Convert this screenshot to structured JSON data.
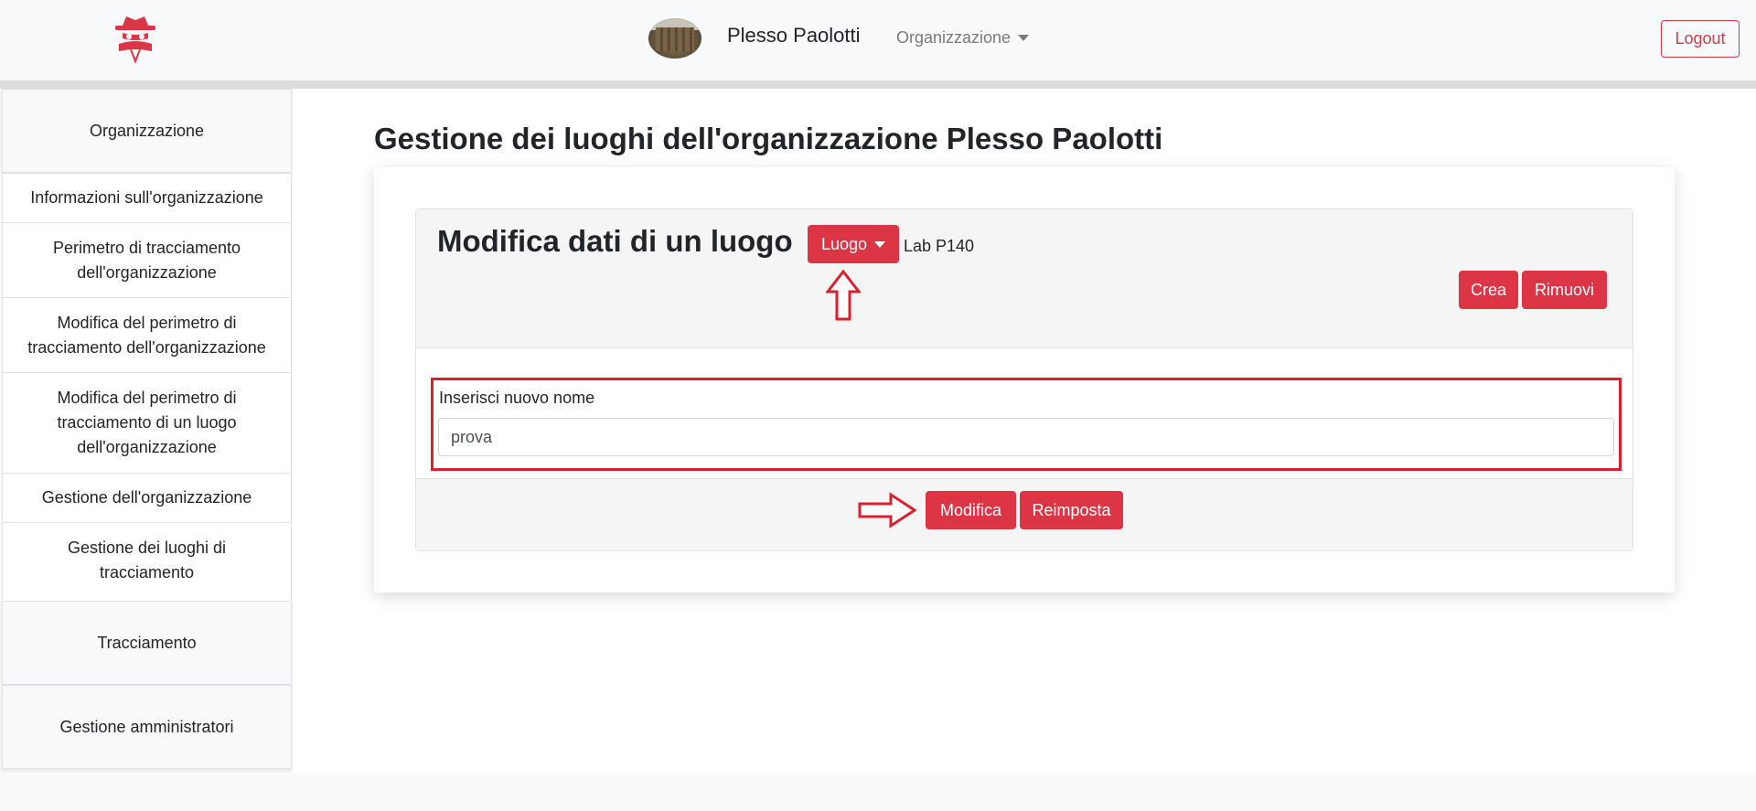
{
  "navbar": {
    "logo_icon": "spy-icon",
    "org_name": "Plesso Paolotti",
    "org_menu_label": "Organizzazione",
    "logout_label": "Logout"
  },
  "sidebar": {
    "section_organizzazione": "Organizzazione",
    "items": [
      {
        "label": "Informazioni sull'organizzazione"
      },
      {
        "label": "Perimetro di tracciamento dell'organizzazione"
      },
      {
        "label": "Modifica del perimetro di tracciamento dell'organizzazione"
      },
      {
        "label": "Modifica del perimetro di tracciamento di un luogo dell'organizzazione"
      },
      {
        "label": "Gestione dell'organizzazione"
      },
      {
        "label": "Gestione dei luoghi di tracciamento"
      }
    ],
    "section_tracciamento": "Tracciamento",
    "section_amministratori": "Gestione amministratori"
  },
  "main": {
    "page_title": "Gestione dei luoghi dell'organizzazione Plesso Paolotti",
    "card_title": "Modifica dati di un luogo",
    "luogo_dropdown_label": "Luogo",
    "selected_luogo": "Lab P140",
    "create_label": "Crea",
    "remove_label": "Rimuovi",
    "field_label": "Inserisci nuovo nome",
    "field_value": "prova",
    "modify_label": "Modifica",
    "reset_label": "Reimposta"
  },
  "colors": {
    "accent": "#dc3545",
    "annotation": "#dc1f2f"
  }
}
